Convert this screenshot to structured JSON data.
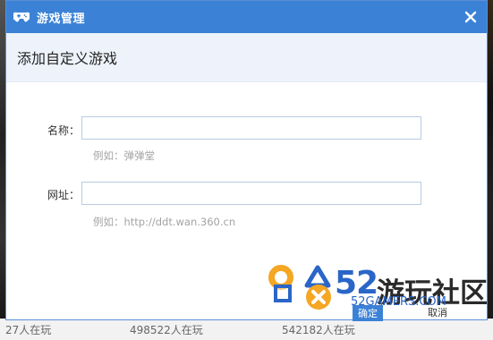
{
  "dialog": {
    "title": "游戏管理",
    "heading": "添加自定义游戏",
    "name_label": "名称：",
    "name_value": "",
    "name_hint": "例如：弹弹堂",
    "url_label": "网址：",
    "url_value": "",
    "url_hint": "例如：http://ddt.wan.360.cn",
    "ok_label": "确定",
    "cancel_label": "取消"
  },
  "background": {
    "bottom_texts": [
      "27人在玩",
      "498522人在玩",
      "542182人在玩"
    ]
  },
  "watermark": {
    "main": "52",
    "cn": "游玩社区",
    "sub": "52GAMERS.COM"
  },
  "colors": {
    "titlebar": "#3b82d6",
    "header_band": "#eef3fb",
    "field_border": "#b8cbe4",
    "hint": "#a3a3a3"
  }
}
